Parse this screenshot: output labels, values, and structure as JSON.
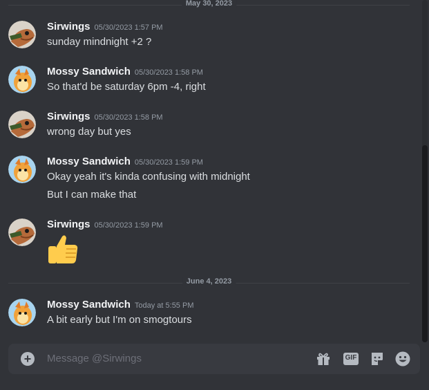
{
  "chat": {
    "dates": {
      "top": "May 30, 2023",
      "mid": "June 4, 2023"
    },
    "messages": [
      {
        "author": "Sirwings",
        "time": "05/30/2023 1:57 PM",
        "lines": [
          "sunday mindnight +2 ?"
        ]
      },
      {
        "author": "Mossy Sandwich",
        "time": "05/30/2023 1:58 PM",
        "lines": [
          "So that'd be saturday 6pm -4, right"
        ]
      },
      {
        "author": "Sirwings",
        "time": "05/30/2023 1:58 PM",
        "lines": [
          "wrong day but yes"
        ]
      },
      {
        "author": "Mossy Sandwich",
        "time": "05/30/2023 1:59 PM",
        "lines": [
          "Okay yeah it's kinda confusing with midnight",
          "But I can make that"
        ]
      },
      {
        "author": "Sirwings",
        "time": "05/30/2023 1:59 PM",
        "lines": [],
        "emoji": "thumbs-up"
      },
      {
        "author": "Mossy Sandwich",
        "time": "Today at 5:55 PM",
        "lines": [
          "A bit early but I'm on smogtours"
        ]
      }
    ]
  },
  "composer": {
    "placeholder": "Message @Sirwings",
    "icons": [
      "plus-circle-icon",
      "gift-icon",
      "gif-icon",
      "sticker-icon",
      "emoji-icon"
    ],
    "gif_label": "GIF"
  },
  "colors": {
    "background": "#313338",
    "author": "#f2f3f5",
    "timestamp": "#949ba4",
    "composer_bg": "#383a40"
  }
}
